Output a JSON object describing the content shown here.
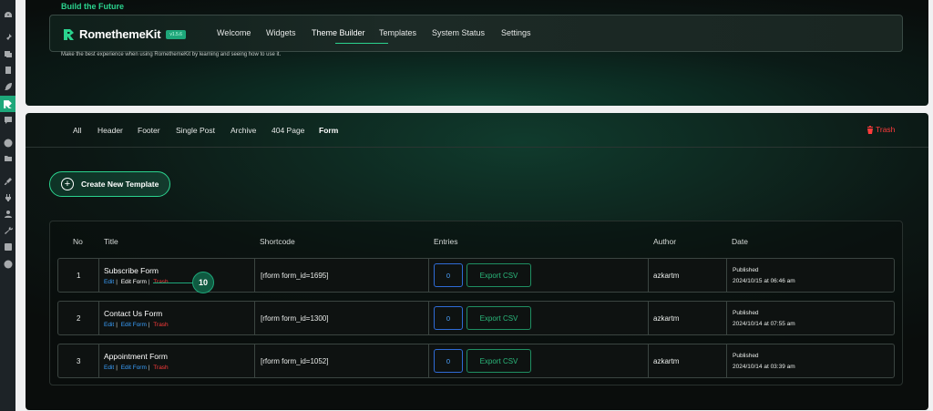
{
  "sidebar": {
    "icons": [
      "dashboard-icon",
      "pin-icon",
      "media-icon",
      "pages-icon",
      "feather-icon",
      "romethemekit-icon",
      "comments-icon",
      "elementor-icon",
      "folder-icon",
      "appearance-icon",
      "plugins-icon",
      "users-icon",
      "tools-icon",
      "settings-icon",
      "play-icon"
    ]
  },
  "header": {
    "brand_tag": "Build the Future",
    "logo_text": "RomethemeKit",
    "version": "v1.5.6",
    "nav": [
      "Welcome",
      "Widgets",
      "Theme Builder",
      "Templates",
      "System Status",
      "Settings"
    ],
    "active_nav": "Theme Builder",
    "tagline": "Make the best experience when using RomethemeKit by learning and seeing how to use it."
  },
  "builder": {
    "tabs": [
      "All",
      "Header",
      "Footer",
      "Single Post",
      "Archive",
      "404 Page",
      "Form"
    ],
    "active_tab": "Form",
    "trash_label": "Trash",
    "create_label": "Create New Template"
  },
  "table": {
    "headers": [
      "No",
      "Title",
      "Shortcode",
      "Entries",
      "Author",
      "Date"
    ],
    "rows": [
      {
        "no": "1",
        "title": "Subscribe Form",
        "edit": "Edit",
        "edit_form": "Edit Form",
        "trash": "Trash",
        "shortcode": "[rform form_id=1695]",
        "entries": "0",
        "export": "Export CSV",
        "author": "azkartm",
        "status": "Published",
        "date": "2024/10/15 at 06:46 am"
      },
      {
        "no": "2",
        "title": "Contact Us Form",
        "edit": "Edit",
        "edit_form": "Edit Form",
        "trash": "Trash",
        "shortcode": "[rform form_id=1300]",
        "entries": "0",
        "export": "Export CSV",
        "author": "azkartm",
        "status": "Published",
        "date": "2024/10/14 at 07:55 am"
      },
      {
        "no": "3",
        "title": "Appointment Form",
        "edit": "Edit",
        "edit_form": "Edit Form",
        "trash": "Trash",
        "shortcode": "[rform form_id=1052]",
        "entries": "0",
        "export": "Export CSV",
        "author": "azkartm",
        "status": "Published",
        "date": "2024/10/14 at 03:39 am"
      }
    ]
  },
  "annotation": {
    "step": "10"
  },
  "colors": {
    "accent": "#2bd38e",
    "danger": "#ff3b3b",
    "link": "#3aa0ff",
    "panel_bg": "#0b1a16"
  }
}
